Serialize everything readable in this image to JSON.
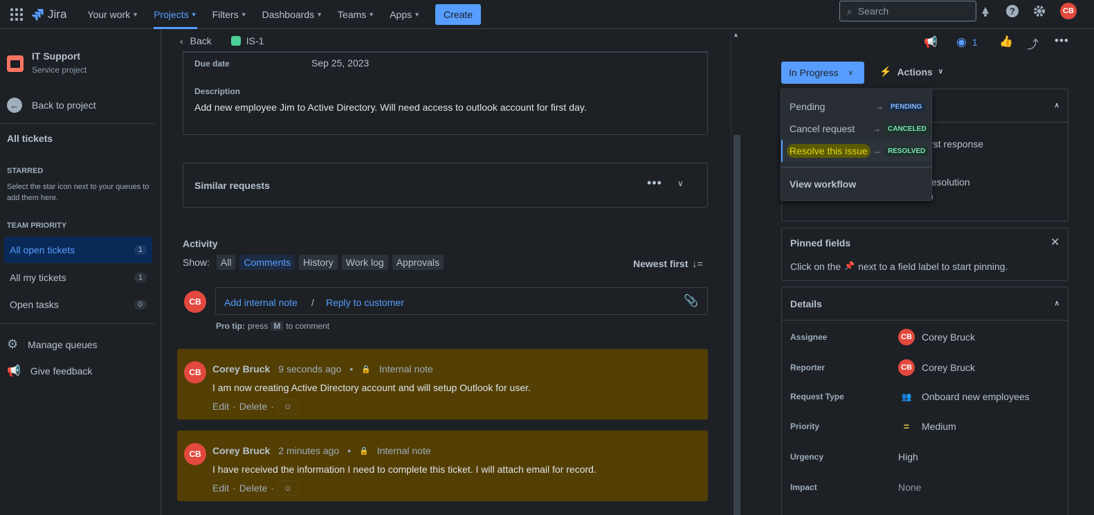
{
  "topnav": {
    "logo_text": "Jira",
    "items": [
      {
        "label": "Your work"
      },
      {
        "label": "Projects"
      },
      {
        "label": "Filters"
      },
      {
        "label": "Dashboards"
      },
      {
        "label": "Teams"
      },
      {
        "label": "Apps"
      }
    ],
    "create_label": "Create",
    "search_placeholder": "Search",
    "avatar_initials": "CB"
  },
  "sidebar": {
    "project_name": "IT Support",
    "project_type": "Service project",
    "back_label": "Back to project",
    "all_tickets": "All tickets",
    "starred_heading": "STARRED",
    "starred_note": "Select the star icon next to your queues to add them here.",
    "team_priority_heading": "TEAM PRIORITY",
    "queues": [
      {
        "label": "All open tickets",
        "count": "1"
      },
      {
        "label": "All my tickets",
        "count": "1"
      },
      {
        "label": "Open tasks",
        "count": "0"
      }
    ],
    "manage_queues": "Manage queues",
    "give_feedback": "Give feedback"
  },
  "main": {
    "back_label": "Back",
    "issue_key": "IS-1",
    "due_date_label": "Due date",
    "due_date_value": "Sep 25, 2023",
    "description_label": "Description",
    "description_value": "Add new employee Jim to Active Directory. Will need access to outlook account for first day.",
    "similar_requests": "Similar requests",
    "activity_label": "Activity",
    "show_label": "Show:",
    "tabs": [
      "All",
      "Comments",
      "History",
      "Work log",
      "Approvals"
    ],
    "sort_label": "Newest first",
    "add_internal_note": "Add internal note",
    "separator": "/",
    "reply_to_customer": "Reply to customer",
    "pro_tip_prefix": "Pro tip:",
    "pro_tip_press": "press",
    "pro_tip_key": "M",
    "pro_tip_suffix": "to comment",
    "comments": [
      {
        "author": "Corey Bruck",
        "time": "9 seconds ago",
        "type": "Internal note",
        "body": "I am now creating Active Directory account and will setup Outlook for user.",
        "edit": "Edit",
        "delete": "Delete"
      },
      {
        "author": "Corey Bruck",
        "time": "2 minutes ago",
        "type": "Internal note",
        "body": "I have received the information I need to complete this ticket. I will attach email for record.",
        "edit": "Edit",
        "delete": "Delete"
      }
    ]
  },
  "right": {
    "watchers_count": "1",
    "status_label": "In Progress",
    "actions_label": "Actions",
    "sla_text_1": "irst response",
    "sla_text_2": "resolution",
    "sla_text_3": "n",
    "pinned_title": "Pinned fields",
    "pinned_hint_before": "Click on the",
    "pinned_hint_after": "next to a field label to start pinning.",
    "details_title": "Details",
    "details": [
      {
        "label": "Assignee",
        "value": "Corey Bruck"
      },
      {
        "label": "Reporter",
        "value": "Corey Bruck"
      },
      {
        "label": "Request Type",
        "value": "Onboard new employees"
      },
      {
        "label": "Priority",
        "value": "Medium"
      },
      {
        "label": "Urgency",
        "value": "High"
      },
      {
        "label": "Impact",
        "value": "None"
      }
    ]
  },
  "dropdown": {
    "items": [
      {
        "label": "Pending",
        "target": "PENDING"
      },
      {
        "label": "Cancel request",
        "target": "CANCELED"
      },
      {
        "label": "Resolve this issue",
        "target": "RESOLVED"
      }
    ],
    "view_workflow": "View workflow"
  },
  "colors": {
    "accent": "#579dff",
    "internal_note_bg": "#533f04",
    "avatar": "#e2483d",
    "highlight": "#e2d615",
    "priority_medium": "#f5cd47"
  }
}
